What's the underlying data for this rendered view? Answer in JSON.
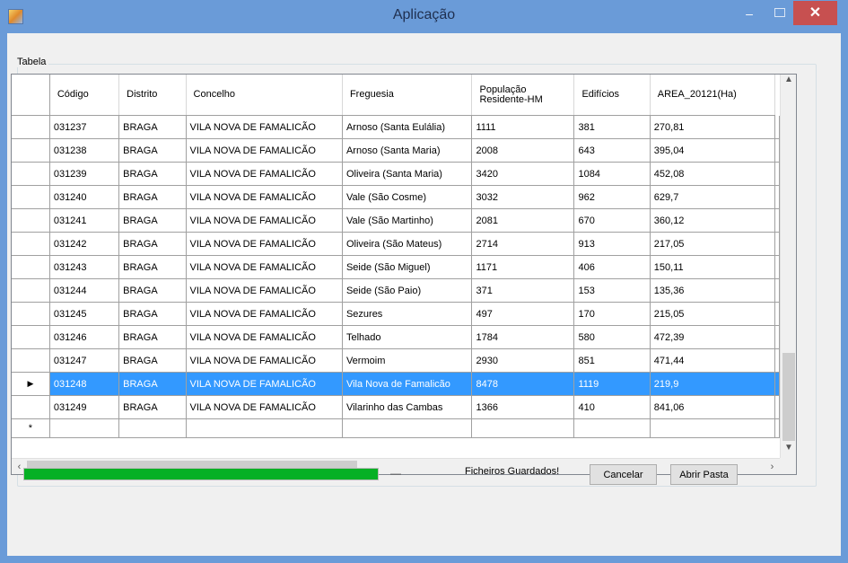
{
  "window": {
    "title": "Aplicação",
    "minimize_glyph": "–",
    "close_glyph": "✕"
  },
  "group": {
    "label": "Tabela"
  },
  "grid": {
    "columns": [
      "Código",
      "Distrito",
      "Concelho",
      "Freguesia",
      "População Residente-HM",
      "Edifícios",
      "AREA_20121(Ha)"
    ],
    "rows": [
      [
        "031237",
        "BRAGA",
        "VILA NOVA DE FAMALICÃO",
        "Arnoso (Santa Eulália)",
        "1111",
        "381",
        "270,81"
      ],
      [
        "031238",
        "BRAGA",
        "VILA NOVA DE FAMALICÃO",
        "Arnoso (Santa Maria)",
        "2008",
        "643",
        "395,04"
      ],
      [
        "031239",
        "BRAGA",
        "VILA NOVA DE FAMALICÃO",
        "Oliveira (Santa Maria)",
        "3420",
        "1084",
        "452,08"
      ],
      [
        "031240",
        "BRAGA",
        "VILA NOVA DE FAMALICÃO",
        "Vale (São Cosme)",
        "3032",
        "962",
        "629,7"
      ],
      [
        "031241",
        "BRAGA",
        "VILA NOVA DE FAMALICÃO",
        "Vale (São Martinho)",
        "2081",
        "670",
        "360,12"
      ],
      [
        "031242",
        "BRAGA",
        "VILA NOVA DE FAMALICÃO",
        "Oliveira (São Mateus)",
        "2714",
        "913",
        "217,05"
      ],
      [
        "031243",
        "BRAGA",
        "VILA NOVA DE FAMALICÃO",
        "Seide (São Miguel)",
        "1171",
        "406",
        "150,11"
      ],
      [
        "031244",
        "BRAGA",
        "VILA NOVA DE FAMALICÃO",
        "Seide (São Paio)",
        "371",
        "153",
        "135,36"
      ],
      [
        "031245",
        "BRAGA",
        "VILA NOVA DE FAMALICÃO",
        "Sezures",
        "497",
        "170",
        "215,05"
      ],
      [
        "031246",
        "BRAGA",
        "VILA NOVA DE FAMALICÃO",
        "Telhado",
        "1784",
        "580",
        "472,39"
      ],
      [
        "031247",
        "BRAGA",
        "VILA NOVA DE FAMALICÃO",
        "Vermoim",
        "2930",
        "851",
        "471,44"
      ],
      [
        "031248",
        "BRAGA",
        "VILA NOVA DE FAMALICÃO",
        "Vila Nova de Famalicão",
        "8478",
        "1119",
        "219,9"
      ],
      [
        "031249",
        "BRAGA",
        "VILA NOVA DE FAMALICÃO",
        "Vilarinho das Cambas",
        "1366",
        "410",
        "841,06"
      ]
    ],
    "selected_row_marker": "▶",
    "new_row_marker": "*"
  },
  "progress": {
    "value": 1.0,
    "trailing": "—"
  },
  "status_text": "Ficheiros Guardados!",
  "buttons": {
    "cancel": "Cancelar",
    "open_folder": "Abrir Pasta"
  },
  "colors": {
    "titlebar": "#6a9bd8",
    "selection": "#3399ff",
    "progress": "#06b025",
    "close": "#c75050"
  },
  "icons": {
    "app": "app-icon",
    "minimize": "minimize-icon",
    "maximize": "maximize-icon",
    "close": "close-icon"
  }
}
